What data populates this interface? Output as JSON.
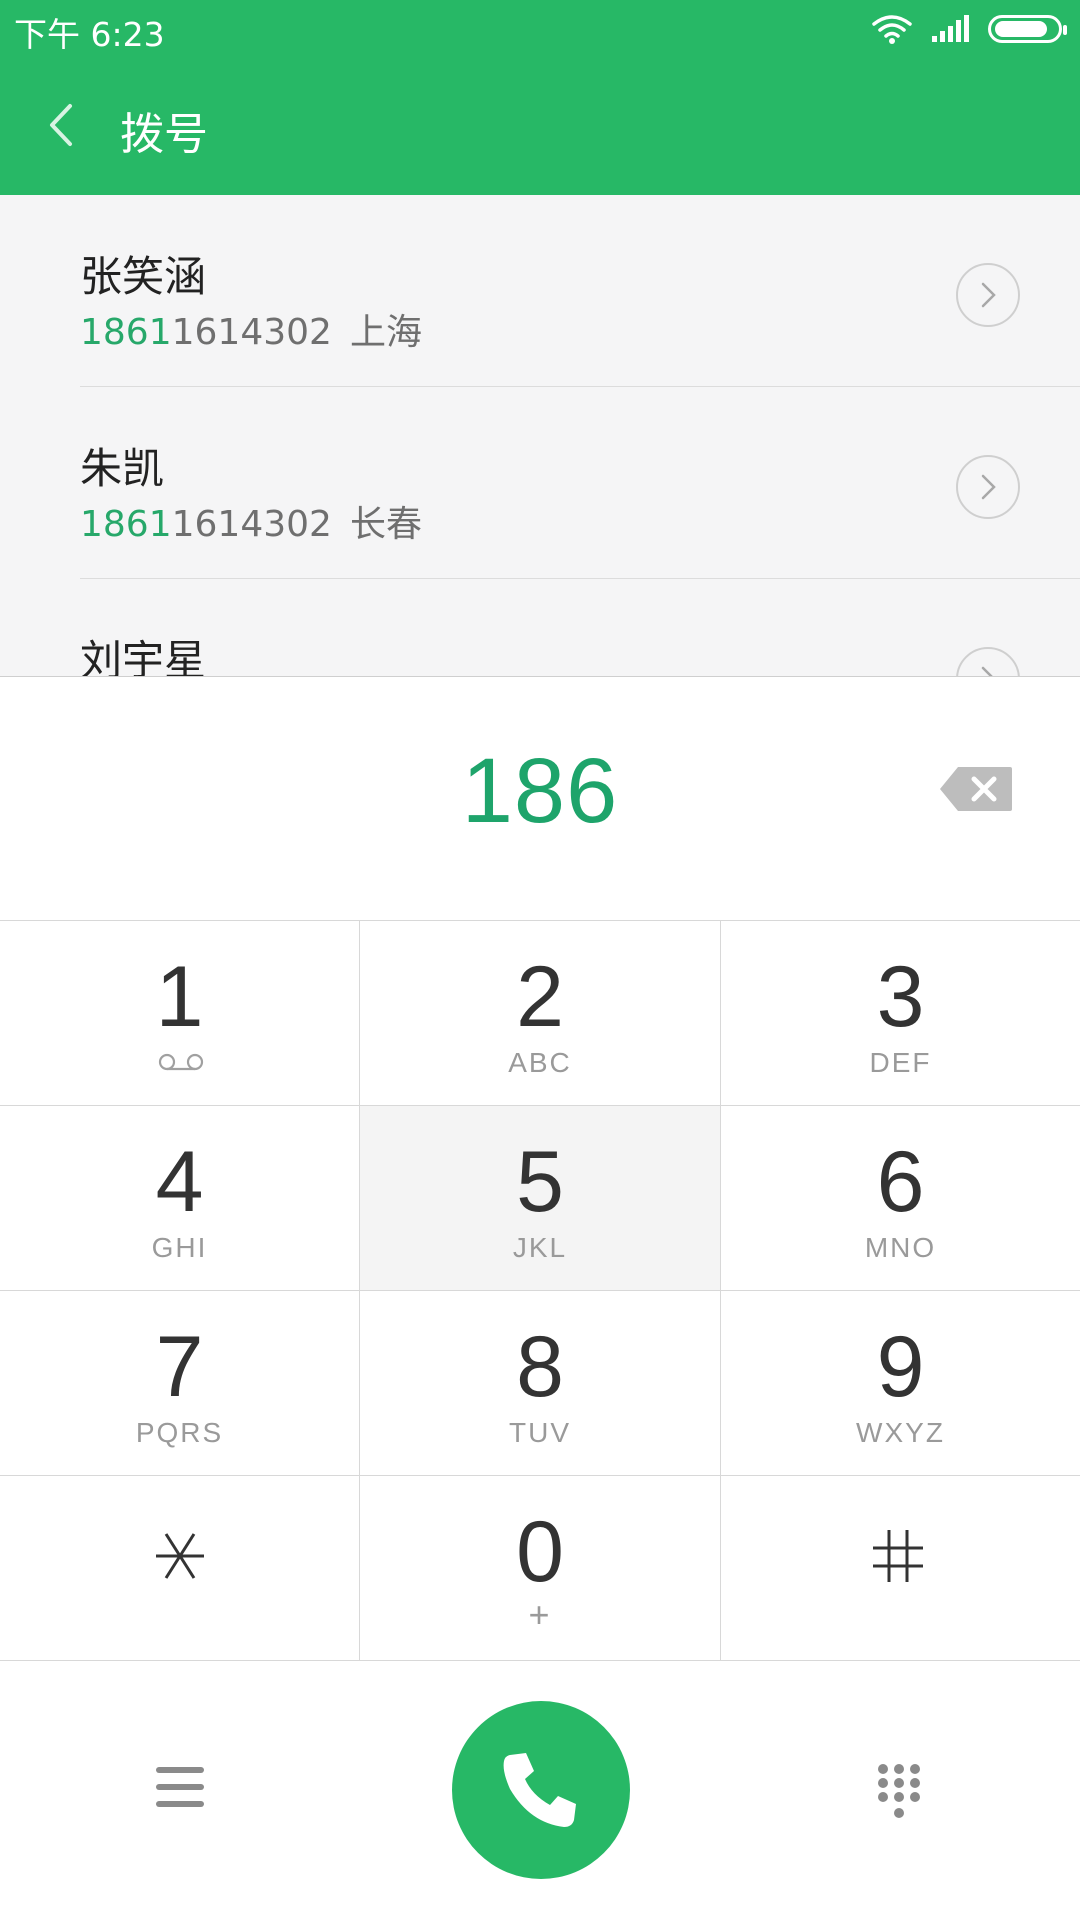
{
  "status_bar": {
    "time": "下午 6:23",
    "icons": [
      "wifi-icon",
      "signal-icon",
      "battery-icon"
    ]
  },
  "header": {
    "back_icon": "chevron-left-icon",
    "title": "拨号"
  },
  "contacts": [
    {
      "name": "张笑涵",
      "number_match": "1861",
      "number_rest": "1614302",
      "location": "上海"
    },
    {
      "name": "朱凯",
      "number_match": "1861",
      "number_rest": "1614302",
      "location": "长春"
    },
    {
      "name": "刘宇星",
      "number_match": "",
      "number_rest": "",
      "location": ""
    }
  ],
  "display": {
    "number": "186",
    "backspace_icon": "backspace-icon"
  },
  "keypad": [
    {
      "digit": "1",
      "letters": "",
      "icon": "voicemail-icon"
    },
    {
      "digit": "2",
      "letters": "ABC"
    },
    {
      "digit": "3",
      "letters": "DEF"
    },
    {
      "digit": "4",
      "letters": "GHI"
    },
    {
      "digit": "5",
      "letters": "JKL"
    },
    {
      "digit": "6",
      "letters": "MNO"
    },
    {
      "digit": "7",
      "letters": "PQRS"
    },
    {
      "digit": "8",
      "letters": "TUV"
    },
    {
      "digit": "9",
      "letters": "WXYZ"
    },
    {
      "digit": "*",
      "letters": "",
      "icon": "asterisk-icon"
    },
    {
      "digit": "0",
      "letters": "+"
    },
    {
      "digit": "#",
      "letters": "",
      "icon": "hash-icon"
    }
  ],
  "bottom_bar": {
    "menu_icon": "menu-icon",
    "call_icon": "phone-icon",
    "dialpad_icon": "dialpad-icon"
  },
  "colors": {
    "accent": "#27b866",
    "match_text": "#27a86a",
    "pressed_key": "#f4f4f4"
  }
}
